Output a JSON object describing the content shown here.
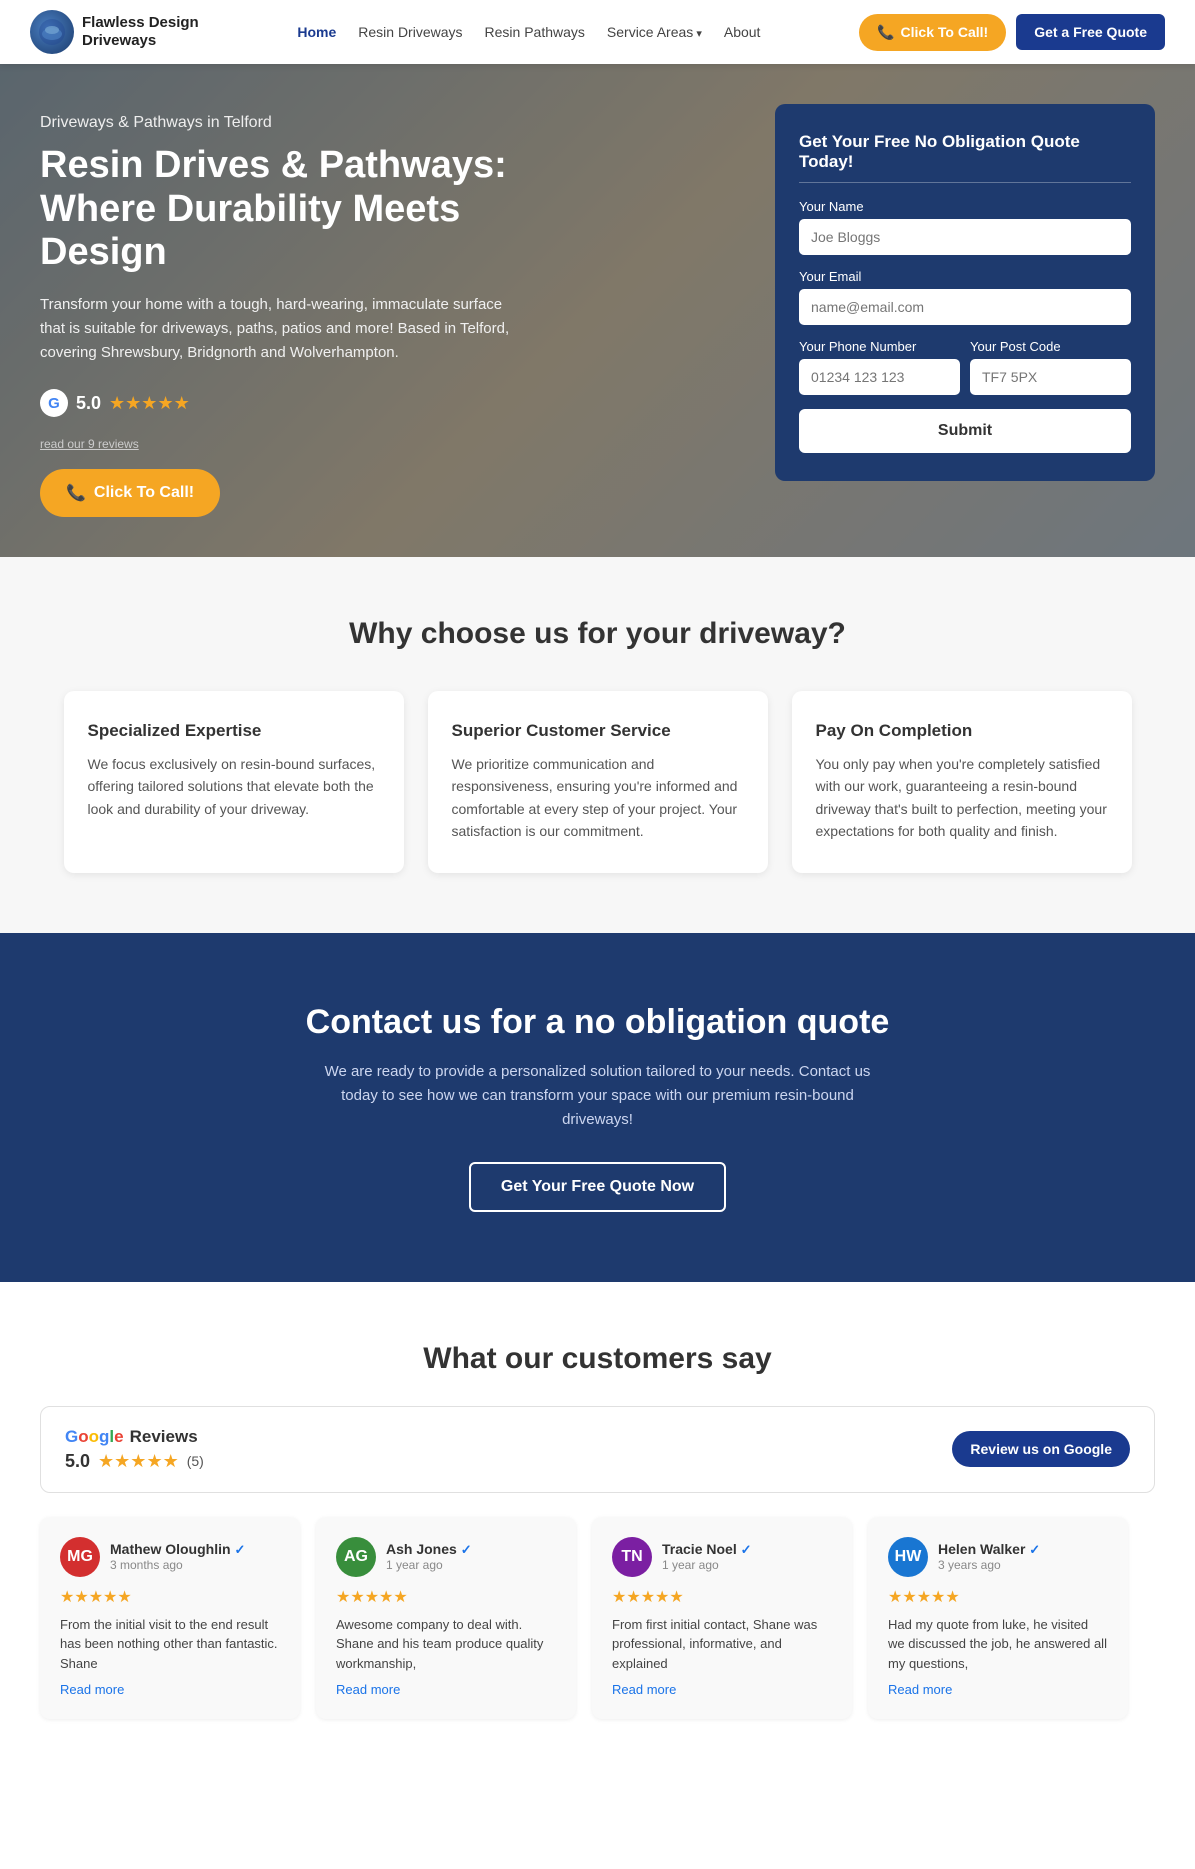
{
  "nav": {
    "logo_icon": "🔷",
    "logo_line1": "Flawless Design",
    "logo_line2": "Driveways",
    "links": [
      {
        "label": "Home",
        "active": true,
        "id": "home"
      },
      {
        "label": "Resin Driveways",
        "active": false,
        "id": "resin-driveways"
      },
      {
        "label": "Resin Pathways",
        "active": false,
        "id": "resin-pathways"
      },
      {
        "label": "Service Areas",
        "active": false,
        "id": "service-areas",
        "dropdown": true
      },
      {
        "label": "About",
        "active": false,
        "id": "about"
      }
    ],
    "cta_call": "Click To Call!",
    "cta_quote": "Get a Free Quote"
  },
  "hero": {
    "tag": "Driveways & Pathways in Telford",
    "title": "Resin Drives & Pathways: Where Durability Meets Design",
    "desc": "Transform your home with a tough, hard-wearing, immaculate surface that is suitable for driveways, paths, patios and more! Based in Telford, covering Shrewsbury, Bridgnorth and Wolverhampton.",
    "rating": "5.0",
    "review_label": "read our 9 reviews",
    "call_label": "Click To Call!"
  },
  "form": {
    "title": "Get Your Free No Obligation Quote Today!",
    "name_label": "Your Name",
    "name_placeholder": "Joe Bloggs",
    "email_label": "Your Email",
    "email_placeholder": "name@email.com",
    "phone_label": "Your Phone Number",
    "phone_placeholder": "01234 123 123",
    "postcode_label": "Your Post Code",
    "postcode_placeholder": "TF7 5PX",
    "submit_label": "Submit"
  },
  "why": {
    "heading": "Why choose us for your driveway?",
    "cards": [
      {
        "title": "Specialized Expertise",
        "desc": "We focus exclusively on resin-bound surfaces, offering tailored solutions that elevate both the look and durability of your driveway."
      },
      {
        "title": "Superior Customer Service",
        "desc": "We prioritize communication and responsiveness, ensuring you're informed and comfortable at every step of your project. Your satisfaction is our commitment."
      },
      {
        "title": "Pay On Completion",
        "desc": "You only pay when you're completely satisfied with our work, guaranteeing a resin-bound driveway that's built to perfection, meeting your expectations for both quality and finish."
      }
    ]
  },
  "cta": {
    "heading": "Contact us for a no obligation quote",
    "desc": "We are ready to provide a personalized solution tailored to your needs. Contact us today to see how we can transform your space with our premium resin-bound driveways!",
    "button": "Get Your Free Quote Now"
  },
  "reviews": {
    "heading": "What our customers say",
    "google_label": "Google",
    "reviews_label": "Reviews",
    "overall_rating": "5.0",
    "review_count": "(5)",
    "review_google_btn": "Review us on Google",
    "items": [
      {
        "name": "Mathew Oloughlin",
        "initials": "MG",
        "avatar_color": "#d32f2f",
        "verified": true,
        "time": "3 months ago",
        "stars": 5,
        "text": "From the initial visit to the end result has been nothing other than fantastic. Shane",
        "read_more": "Read more"
      },
      {
        "name": "Ash Jones",
        "initials": "AG",
        "avatar_color": "#388e3c",
        "verified": true,
        "time": "1 year ago",
        "stars": 5,
        "text": "Awesome company to deal with. Shane and his team produce quality workmanship,",
        "read_more": "Read more"
      },
      {
        "name": "Tracie Noel",
        "initials": "TN",
        "avatar_color": "#7b1fa2",
        "verified": true,
        "time": "1 year ago",
        "stars": 5,
        "text": "From first initial contact, Shane was professional, informative, and explained",
        "read_more": "Read more"
      },
      {
        "name": "Helen Walker",
        "initials": "HW",
        "avatar_color": "#1976d2",
        "verified": true,
        "time": "3 years ago",
        "stars": 5,
        "text": "Had my quote from luke, he visited we discussed the job, he answered all my questions,",
        "read_more": "Read more"
      }
    ]
  }
}
